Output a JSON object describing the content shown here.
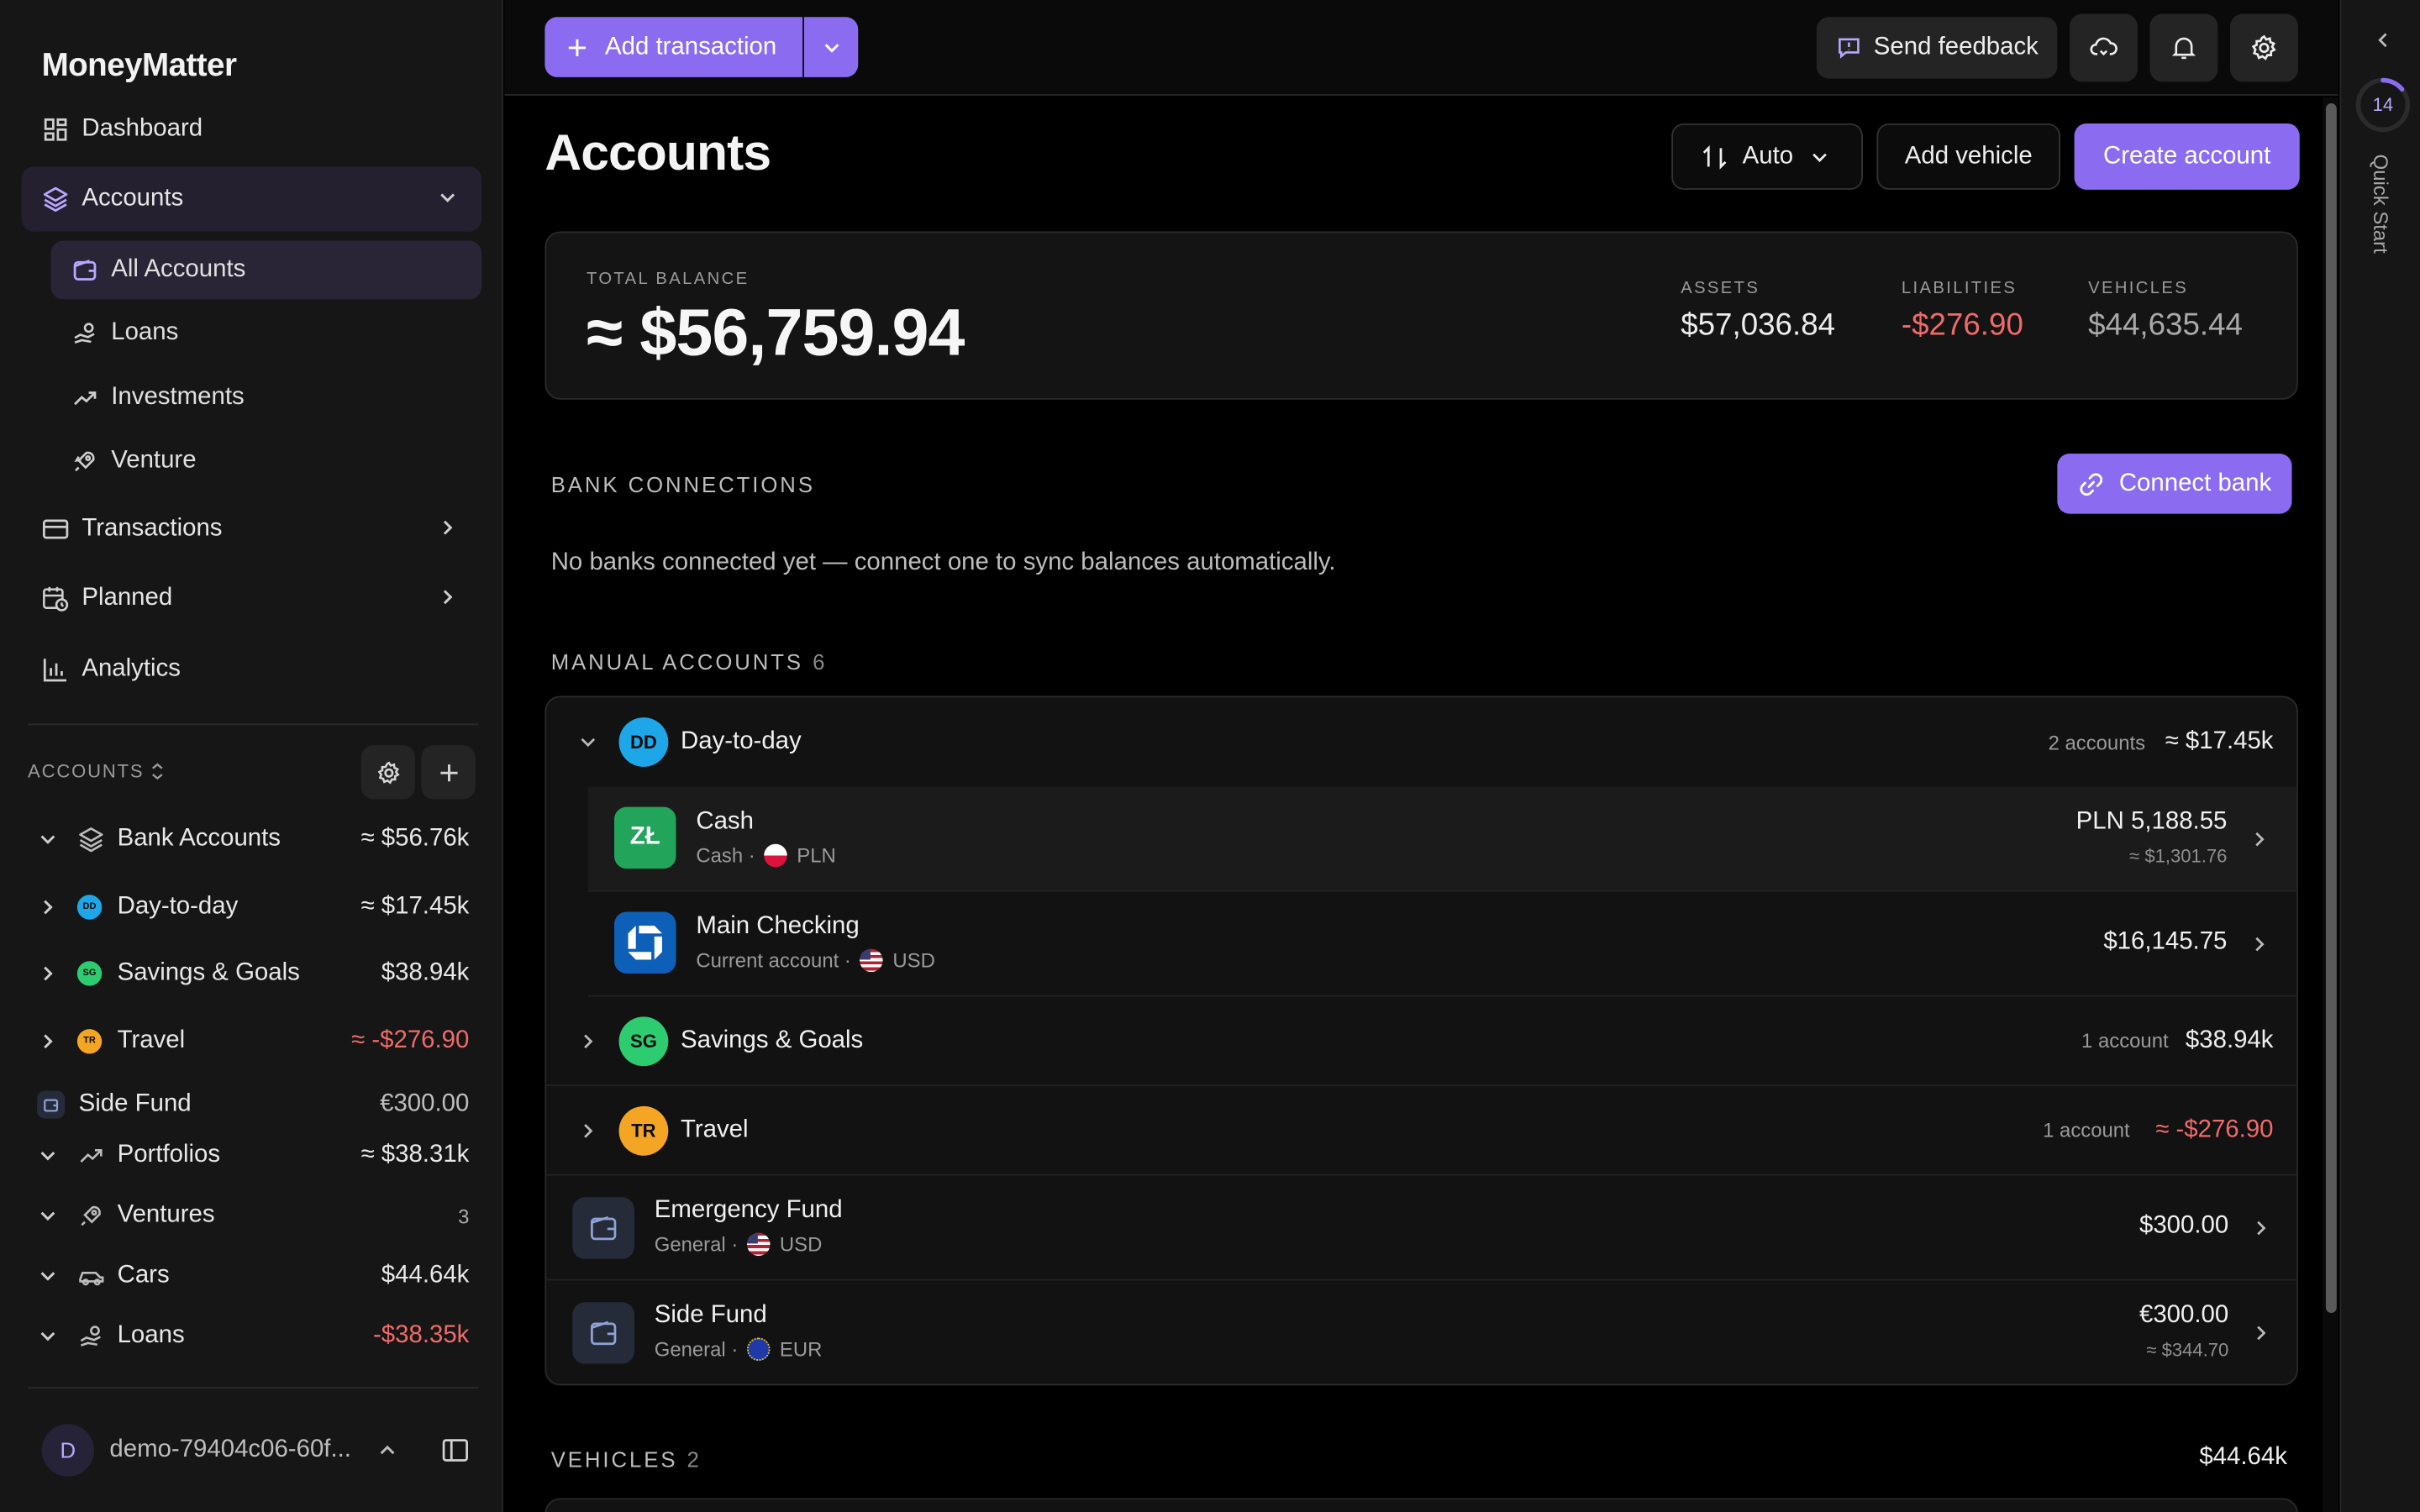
{
  "app": {
    "name": "MoneyMatter"
  },
  "sidebar": {
    "nav": [
      {
        "label": "Dashboard",
        "icon": "dashboard-icon"
      },
      {
        "label": "Accounts",
        "icon": "layers-icon"
      },
      {
        "label": "Transactions",
        "icon": "card-icon"
      },
      {
        "label": "Planned",
        "icon": "calendar-clock-icon"
      },
      {
        "label": "Analytics",
        "icon": "bar-chart-icon"
      }
    ],
    "sub": [
      {
        "label": "All Accounts",
        "icon": "wallet-icon"
      },
      {
        "label": "Loans",
        "icon": "hand-coins-icon"
      },
      {
        "label": "Investments",
        "icon": "trending-up-icon"
      },
      {
        "label": "Venture",
        "icon": "rocket-icon"
      }
    ],
    "accounts_heading": "ACCOUNTS",
    "tree": [
      {
        "label": "Bank Accounts",
        "value": "≈ $56.76k"
      },
      {
        "label": "Day-to-day",
        "value": "≈ $17.45k",
        "badge": "DD"
      },
      {
        "label": "Savings & Goals",
        "value": "$38.94k",
        "badge": "SG"
      },
      {
        "label": "Travel",
        "value": "≈ -$276.90",
        "badge": "TR"
      },
      {
        "label": "Side Fund",
        "value": "€300.00"
      },
      {
        "label": "Portfolios",
        "value": "≈ $38.31k"
      },
      {
        "label": "Ventures",
        "value": "3"
      },
      {
        "label": "Cars",
        "value": "$44.64k"
      },
      {
        "label": "Loans",
        "value": "-$38.35k"
      }
    ],
    "user": {
      "initial": "D",
      "name": "demo-79404c06-60f..."
    }
  },
  "topbar": {
    "add_transaction": "Add transaction",
    "send_feedback": "Send feedback"
  },
  "page": {
    "title": "Accounts",
    "sort_label": "Auto",
    "add_vehicle": "Add vehicle",
    "create_account": "Create account"
  },
  "summary": {
    "total_label": "TOTAL BALANCE",
    "total_value": "≈ $56,759.94",
    "assets_label": "ASSETS",
    "assets_value": "$57,036.84",
    "liabilities_label": "LIABILITIES",
    "liabilities_value": "-$276.90",
    "vehicles_label": "VEHICLES",
    "vehicles_value": "$44,635.44"
  },
  "bank_connections": {
    "label": "BANK CONNECTIONS",
    "connect_button": "Connect bank",
    "empty_text": "No banks connected yet — connect one to sync balances automatically."
  },
  "manual_accounts": {
    "label": "MANUAL ACCOUNTS",
    "count": "6",
    "groups": [
      {
        "badge": "DD",
        "name": "Day-to-day",
        "count": "2 accounts",
        "total": "≈ $17.45k"
      },
      {
        "badge": "SG",
        "name": "Savings & Goals",
        "count": "1 account",
        "total": "$38.94k"
      },
      {
        "badge": "TR",
        "name": "Travel",
        "count": "1 account",
        "total": "≈ -$276.90"
      }
    ],
    "accounts": [
      {
        "logo": "ZŁ",
        "name": "Cash",
        "type": "Cash ·",
        "currency": "PLN",
        "amount": "PLN 5,188.55",
        "converted": "≈ $1,301.76"
      },
      {
        "name": "Main Checking",
        "type": "Current account ·",
        "currency": "USD",
        "amount": "$16,145.75"
      },
      {
        "name": "Emergency Fund",
        "type": "General ·",
        "currency": "USD",
        "amount": "$300.00"
      },
      {
        "name": "Side Fund",
        "type": "General ·",
        "currency": "EUR",
        "amount": "€300.00",
        "converted": "≈ $344.70"
      }
    ]
  },
  "vehicles": {
    "label": "VEHICLES",
    "count": "2",
    "total": "$44.64k"
  },
  "quick_start": {
    "label": "Quick Start",
    "progress": "14"
  },
  "colors": {
    "accent": "#8b6cf0",
    "negative": "#f06a6a",
    "dd_badge": "#1ea7e8",
    "sg_badge": "#2ecc71",
    "tr_badge": "#f5a524"
  }
}
